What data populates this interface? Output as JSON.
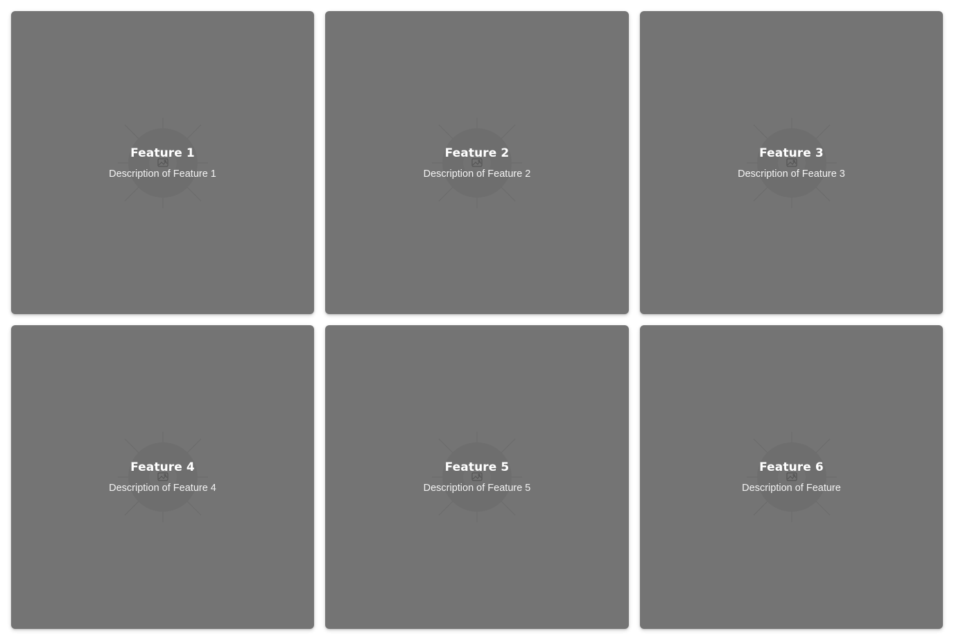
{
  "colors": {
    "card_background": "#747474",
    "text": "#ffffff"
  },
  "cards": [
    {
      "title": "Feature 1",
      "description": "Description of Feature 1",
      "icon": "image-placeholder-icon"
    },
    {
      "title": "Feature 2",
      "description": "Description of Feature 2",
      "icon": "image-placeholder-icon"
    },
    {
      "title": "Feature 3",
      "description": "Description of Feature 3",
      "icon": "image-placeholder-icon"
    },
    {
      "title": "Feature 4",
      "description": "Description of Feature 4",
      "icon": "image-placeholder-icon"
    },
    {
      "title": "Feature 5",
      "description": "Description of Feature 5",
      "icon": "image-placeholder-icon"
    },
    {
      "title": "Feature 6",
      "description": "Description of Feature",
      "icon": "image-placeholder-icon"
    }
  ]
}
